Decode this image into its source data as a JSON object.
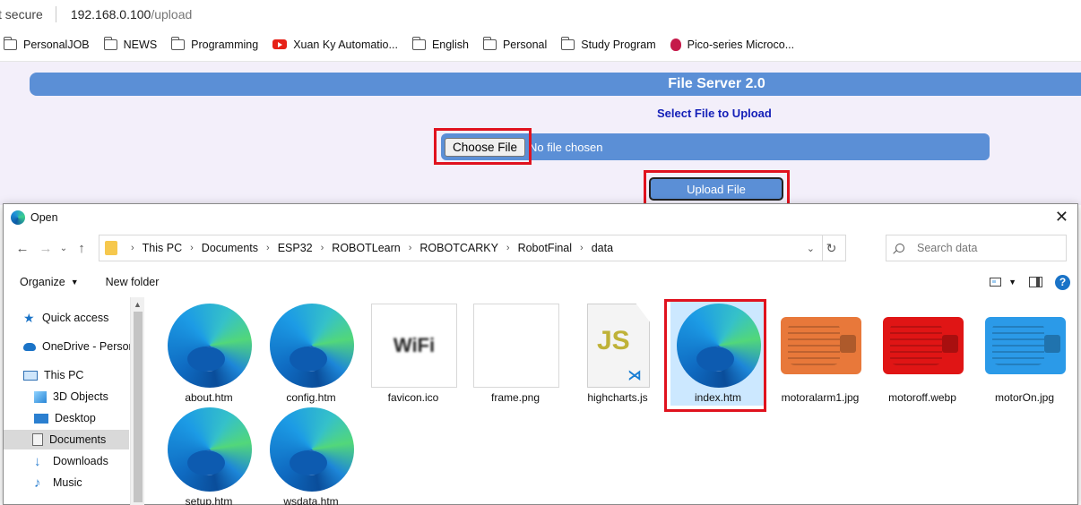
{
  "browser": {
    "security_text": "t secure",
    "url_host": "192.168.0.100",
    "url_path": "/upload"
  },
  "bookmarks": [
    {
      "label": "PersonalJOB",
      "icon": "folder-icon"
    },
    {
      "label": "NEWS",
      "icon": "folder-icon"
    },
    {
      "label": "Programming",
      "icon": "folder-icon"
    },
    {
      "label": "Xuan Ky Automatio...",
      "icon": "youtube-icon"
    },
    {
      "label": "English",
      "icon": "folder-icon"
    },
    {
      "label": "Personal",
      "icon": "folder-icon"
    },
    {
      "label": "Study Program",
      "icon": "folder-icon"
    },
    {
      "label": "Pico-series Microco...",
      "icon": "raspberry-pi-icon"
    }
  ],
  "webpage": {
    "banner_title": "File Server 2.0",
    "select_label": "Select File to Upload",
    "choose_file_label": "Choose File",
    "no_file_text": "No file chosen",
    "upload_label": "Upload File",
    "highlight_color": "#e0121e",
    "accent_color": "#5b8fd6"
  },
  "dialog": {
    "title": "Open",
    "close_symbol": "✕",
    "breadcrumbs": [
      "This PC",
      "Documents",
      "ESP32",
      "ROBOTLearn",
      "ROBOTCARKY",
      "RobotFinal",
      "data"
    ],
    "search_placeholder": "Search data",
    "organize_label": "Organize",
    "new_folder_label": "New folder",
    "help_label": "?",
    "sidebar": [
      {
        "label": "Quick access",
        "icon": "star-icon"
      },
      {
        "label": "OneDrive - Person",
        "icon": "cloud-icon"
      },
      {
        "label": "This PC",
        "icon": "computer-icon"
      },
      {
        "label": "3D Objects",
        "icon": "cube-icon"
      },
      {
        "label": "Desktop",
        "icon": "desktop-icon"
      },
      {
        "label": "Documents",
        "icon": "documents-icon"
      },
      {
        "label": "Downloads",
        "icon": "download-icon"
      },
      {
        "label": "Music",
        "icon": "music-icon"
      }
    ],
    "files": [
      {
        "name": "about.htm",
        "type": "edge-html"
      },
      {
        "name": "config.htm",
        "type": "edge-html"
      },
      {
        "name": "favicon.ico",
        "type": "icon-image"
      },
      {
        "name": "frame.png",
        "type": "blank-image"
      },
      {
        "name": "highcharts.js",
        "type": "js-file"
      },
      {
        "name": "index.htm",
        "type": "edge-html",
        "selected": true
      },
      {
        "name": "motoralarm1.jpg",
        "type": "motor-orange"
      },
      {
        "name": "motoroff.webp",
        "type": "motor-red"
      },
      {
        "name": "motorOn.jpg",
        "type": "motor-blue"
      },
      {
        "name": "setup.htm",
        "type": "edge-html"
      },
      {
        "name": "wsdata.htm",
        "type": "edge-html"
      }
    ],
    "favicon_glyph": "WiFi",
    "js_glyph": "JS",
    "vscode_glyph": "⋊"
  }
}
